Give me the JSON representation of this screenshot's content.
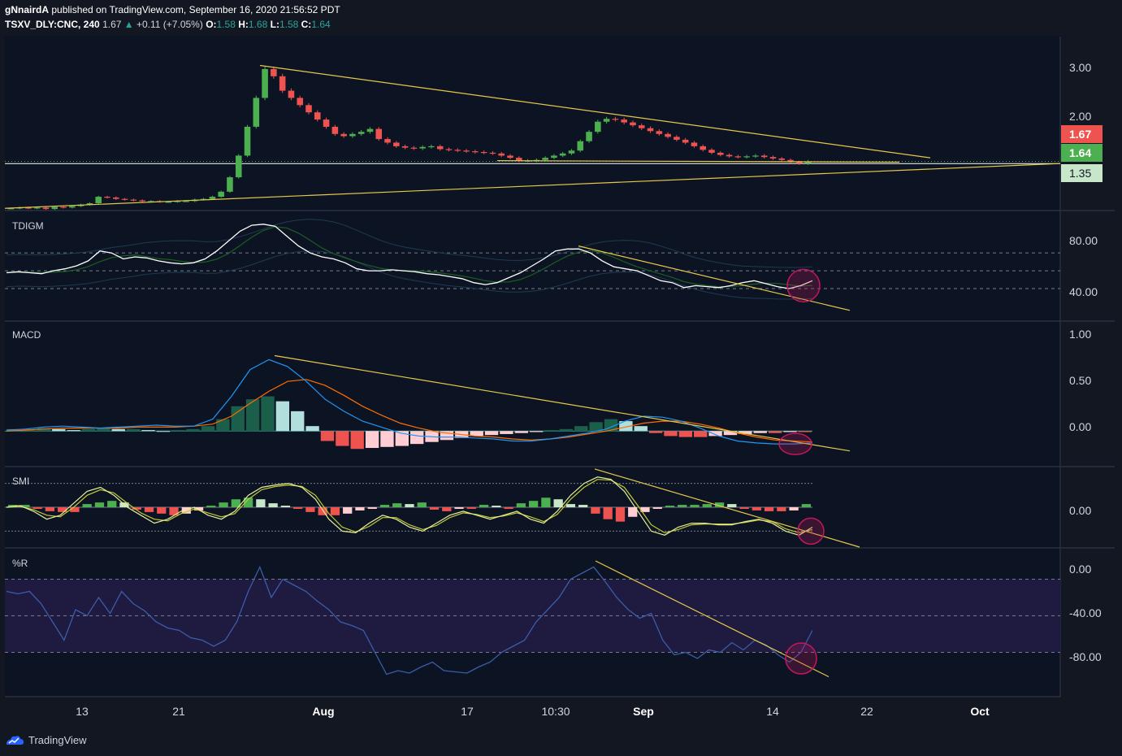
{
  "header": {
    "publisher": "gNnairdA",
    "published_text": "published on TradingView.com, September 16, 2020 21:56:52 PDT"
  },
  "symbol_bar": {
    "symbol": "TSXV_DLY:CNC, 240",
    "last": "1.67",
    "change": "+0.11 (+7.05%)",
    "o_label": "O:",
    "o_value": "1.58",
    "h_label": "H:",
    "h_value": "1.68",
    "l_label": "L:",
    "l_value": "1.58",
    "c_label": "C:",
    "c_value": "1.64",
    "up_arrow": "▲"
  },
  "panes": {
    "tdigm": "TDIGM",
    "macd": "MACD",
    "smi": "SMI",
    "wr": "%R"
  },
  "price_tags": {
    "last": {
      "text": "1.67",
      "color": "#ef5350"
    },
    "line": {
      "text": "1.64",
      "color": "#26a69a"
    },
    "support": {
      "text": "1.35",
      "color": "#c8e6c9"
    }
  },
  "axis_labels": {
    "price": [
      "3.00",
      "2.00"
    ],
    "tdigm": [
      "80.00",
      "40.00"
    ],
    "macd": [
      "1.00",
      "0.50",
      "0.00"
    ],
    "smi": [
      "0.00"
    ],
    "wr": [
      "0.00",
      "-40.00",
      "-80.00"
    ]
  },
  "time_axis": [
    {
      "text": "13",
      "bold": false
    },
    {
      "text": "21",
      "bold": false
    },
    {
      "text": "Aug",
      "bold": true
    },
    {
      "text": "17",
      "bold": false
    },
    {
      "text": "10:30",
      "bold": false
    },
    {
      "text": "Sep",
      "bold": true
    },
    {
      "text": "14",
      "bold": false
    },
    {
      "text": "22",
      "bold": false
    },
    {
      "text": "Oct",
      "bold": true
    }
  ],
  "footer": {
    "brand": "TradingView"
  },
  "colors": {
    "background": "#0c1424",
    "up": "#4caf50",
    "down": "#ef5350",
    "trendline": "#e6c84a",
    "circle": "#c2185b",
    "tdi_main": "#ffffff",
    "macd_line": "#2196f3",
    "signal_line": "#ff6d00",
    "wr_line": "#3d5ca8",
    "wr_zone": "#1e1a40"
  },
  "chart_data": [
    {
      "type": "candlestick",
      "title": "TSXV_DLY:CNC, 240",
      "ylim": [
        1.0,
        3.4
      ],
      "ticks": [
        3.0,
        2.0
      ],
      "last_price": 1.67,
      "levels": [
        1.64,
        1.35
      ],
      "close": [
        1.02,
        1.03,
        1.02,
        1.03,
        1.01,
        1.04,
        1.03,
        1.05,
        1.07,
        1.09,
        1.18,
        1.17,
        1.15,
        1.14,
        1.13,
        1.12,
        1.12,
        1.11,
        1.11,
        1.12,
        1.12,
        1.14,
        1.15,
        1.18,
        1.25,
        1.45,
        1.75,
        2.15,
        2.55,
        2.95,
        2.85,
        2.65,
        2.55,
        2.45,
        2.35,
        2.25,
        2.15,
        2.05,
        2.02,
        2.05,
        2.08,
        2.12,
        1.98,
        1.93,
        1.88,
        1.86,
        1.85,
        1.87,
        1.88,
        1.84,
        1.83,
        1.82,
        1.81,
        1.8,
        1.79,
        1.78,
        1.75,
        1.72,
        1.68,
        1.68,
        1.69,
        1.72,
        1.75,
        1.78,
        1.82,
        1.95,
        2.08,
        2.22,
        2.26,
        2.25,
        2.21,
        2.17,
        2.13,
        2.09,
        2.05,
        2.01,
        1.97,
        1.93,
        1.88,
        1.83,
        1.79,
        1.76,
        1.74,
        1.73,
        1.74,
        1.75,
        1.73,
        1.71,
        1.69,
        1.66,
        1.64,
        1.67
      ]
    },
    {
      "type": "line",
      "title": "TDIGM",
      "ylim": [
        0,
        110
      ],
      "ticks": [
        80,
        40
      ],
      "levels": [
        68,
        50,
        32
      ],
      "values": [
        48,
        49,
        48,
        47,
        50,
        52,
        55,
        60,
        70,
        68,
        62,
        64,
        63,
        60,
        58,
        57,
        58,
        62,
        70,
        80,
        90,
        96,
        97,
        95,
        85,
        75,
        68,
        64,
        62,
        58,
        52,
        50,
        50,
        51,
        50,
        49,
        47,
        46,
        44,
        42,
        38,
        36,
        38,
        43,
        48,
        55,
        62,
        70,
        72,
        72,
        68,
        60,
        54,
        52,
        50,
        45,
        40,
        38,
        33,
        35,
        34,
        33,
        35,
        38,
        40,
        37,
        34,
        32,
        35,
        40
      ]
    },
    {
      "type": "bar+line",
      "title": "MACD",
      "ylim": [
        -0.35,
        1.1
      ],
      "ticks": [
        1.0,
        0.5,
        0.0
      ],
      "histogram": [
        0.02,
        0.02,
        0.03,
        0.02,
        0.01,
        0.02,
        0.03,
        0.02,
        0.02,
        0.01,
        0.0,
        0.01,
        0.02,
        0.05,
        0.12,
        0.25,
        0.32,
        0.35,
        0.3,
        0.2,
        0.05,
        -0.1,
        -0.15,
        -0.18,
        -0.17,
        -0.16,
        -0.15,
        -0.13,
        -0.11,
        -0.09,
        -0.07,
        -0.05,
        -0.04,
        -0.03,
        -0.02,
        -0.01,
        0.01,
        0.02,
        0.05,
        0.09,
        0.12,
        0.1,
        0.05,
        -0.02,
        -0.05,
        -0.06,
        -0.06,
        -0.05,
        -0.04,
        -0.03,
        -0.02,
        -0.02,
        -0.01,
        -0.01
      ],
      "macd": [
        0.01,
        0.02,
        0.04,
        0.05,
        0.04,
        0.03,
        0.04,
        0.05,
        0.06,
        0.05,
        0.05,
        0.12,
        0.35,
        0.62,
        0.72,
        0.65,
        0.5,
        0.32,
        0.2,
        0.1,
        0.04,
        -0.02,
        -0.05,
        -0.06,
        -0.06,
        -0.07,
        -0.08,
        -0.1,
        -0.1,
        -0.08,
        -0.05,
        -0.02,
        0.02,
        0.1,
        0.15,
        0.14,
        0.1,
        0.03,
        -0.05,
        -0.1,
        -0.12,
        -0.13,
        -0.13,
        -0.12
      ],
      "signal": [
        0.0,
        0.01,
        0.02,
        0.03,
        0.03,
        0.03,
        0.03,
        0.04,
        0.04,
        0.04,
        0.05,
        0.07,
        0.15,
        0.28,
        0.4,
        0.5,
        0.52,
        0.46,
        0.36,
        0.25,
        0.16,
        0.08,
        0.03,
        -0.01,
        -0.03,
        -0.05,
        -0.06,
        -0.08,
        -0.09,
        -0.08,
        -0.06,
        -0.03,
        0.0,
        0.04,
        0.08,
        0.1,
        0.1,
        0.07,
        0.03,
        -0.02,
        -0.06,
        -0.09,
        -0.1,
        -0.11
      ]
    },
    {
      "type": "bar+line",
      "title": "SMI",
      "ylim": [
        -50,
        50
      ],
      "ticks": [
        0
      ],
      "levels": [
        30,
        -30
      ],
      "histogram": [
        3,
        3,
        -2,
        -5,
        -6,
        -6,
        4,
        6,
        8,
        6,
        -3,
        -6,
        -8,
        -10,
        -8,
        -4,
        2,
        6,
        10,
        12,
        10,
        5,
        2,
        -2,
        -6,
        -10,
        -10,
        -8,
        -4,
        -2,
        3,
        5,
        4,
        6,
        -3,
        -5,
        -2,
        -2,
        3,
        2,
        -2,
        5,
        8,
        12,
        10,
        4,
        3,
        -8,
        -15,
        -18,
        -12,
        -6,
        -2,
        2,
        3,
        3,
        4,
        6,
        4,
        -2,
        -4,
        -5,
        -5,
        -4,
        4
      ],
      "smi": [
        0,
        2,
        -5,
        -15,
        -10,
        5,
        20,
        25,
        15,
        0,
        -10,
        -20,
        -15,
        -5,
        0,
        -10,
        -15,
        -5,
        15,
        25,
        28,
        30,
        25,
        10,
        -15,
        -30,
        -32,
        -20,
        -10,
        -15,
        -25,
        -30,
        -20,
        -10,
        -5,
        -10,
        -15,
        -10,
        -5,
        -15,
        -20,
        -5,
        15,
        30,
        38,
        35,
        20,
        -5,
        -30,
        -35,
        -25,
        -20,
        -20,
        -22,
        -22,
        -18,
        -15,
        -20,
        -30,
        -35,
        -25
      ],
      "signal": [
        0,
        1,
        -3,
        -10,
        -12,
        0,
        15,
        22,
        18,
        5,
        -7,
        -15,
        -17,
        -8,
        -2,
        -7,
        -12,
        -8,
        10,
        22,
        26,
        28,
        26,
        15,
        -8,
        -25,
        -31,
        -24,
        -13,
        -13,
        -22,
        -28,
        -23,
        -13,
        -7,
        -9,
        -13,
        -11,
        -7,
        -12,
        -18,
        -9,
        10,
        25,
        35,
        34,
        25,
        2,
        -22,
        -32,
        -28,
        -22,
        -21,
        -21,
        -21,
        -19,
        -16,
        -18,
        -27,
        -32,
        -28
      ]
    },
    {
      "type": "line",
      "title": "%R",
      "ylim": [
        -115,
        5
      ],
      "ticks": [
        0,
        -40,
        -80
      ],
      "levels": [
        -20,
        -50,
        -80
      ],
      "values": [
        -30,
        -32,
        -30,
        -40,
        -55,
        -70,
        -45,
        -50,
        -35,
        -48,
        -30,
        -40,
        -46,
        -55,
        -60,
        -62,
        -68,
        -70,
        -75,
        -70,
        -55,
        -30,
        -10,
        -35,
        -20,
        -25,
        -30,
        -38,
        -45,
        -55,
        -58,
        -62,
        -80,
        -98,
        -95,
        -97,
        -92,
        -88,
        -95,
        -96,
        -97,
        -92,
        -88,
        -80,
        -75,
        -70,
        -55,
        -45,
        -35,
        -20,
        -15,
        -10,
        -22,
        -35,
        -45,
        -52,
        -48,
        -70,
        -82,
        -80,
        -85,
        -78,
        -80,
        -72,
        -78,
        -70,
        -74,
        -82,
        -88,
        -80,
        -62
      ]
    }
  ]
}
